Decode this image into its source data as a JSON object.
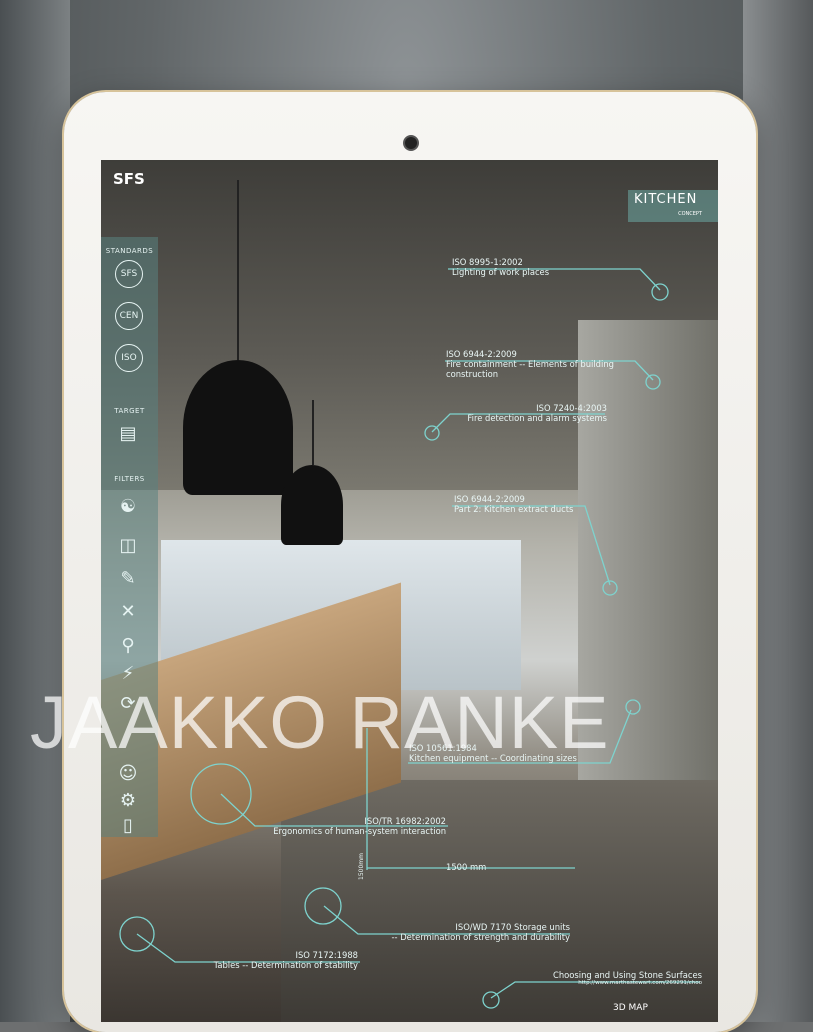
{
  "brand": "SFS",
  "sidebar": {
    "standards_label": "STANDARDS",
    "standards": [
      "SFS",
      "CEN",
      "ISO"
    ],
    "target_label": "TARGET",
    "filters_label": "FILTERS"
  },
  "header": {
    "title": "KITCHEN",
    "subtitle": "CONCEPT"
  },
  "annotations": [
    {
      "line1": "ISO 8995-1:2002",
      "line2": "Lighting of work places"
    },
    {
      "line1": "ISO 6944-2:2009",
      "line2": "Fire containment -- Elements of building",
      "line3": "construction"
    },
    {
      "line1": "ISO 7240-4:2003",
      "line2": "Fire detection and alarm systems"
    },
    {
      "line1": "ISO 6944-2:2009",
      "line2": "Part 2: Kitchen extract ducts"
    },
    {
      "line1": "ISO 10561:1984",
      "line2": "Kitchen equipment -- Coordinating sizes"
    },
    {
      "line1": "ISO/TR 16982:2002",
      "line2": "Ergonomics of human-system interaction"
    },
    {
      "line1": "ISO/WD 7170 Storage units",
      "line2": "-- Determination of strength and durability"
    },
    {
      "line1": "ISO 7172:1988",
      "line2": "Tables -- Determination of stability"
    },
    {
      "line1": "Choosing and Using Stone Surfaces",
      "line2": "http://www.marthastewart.com/269291/choo"
    }
  ],
  "dimensions": {
    "width": "1500 mm",
    "height": "1500mm"
  },
  "watermark": "JAAKKO RANKE",
  "footer": {
    "map_label": "3D MAP"
  },
  "colors": {
    "accent": "#7ed3ce",
    "panel": "#5a8280"
  }
}
